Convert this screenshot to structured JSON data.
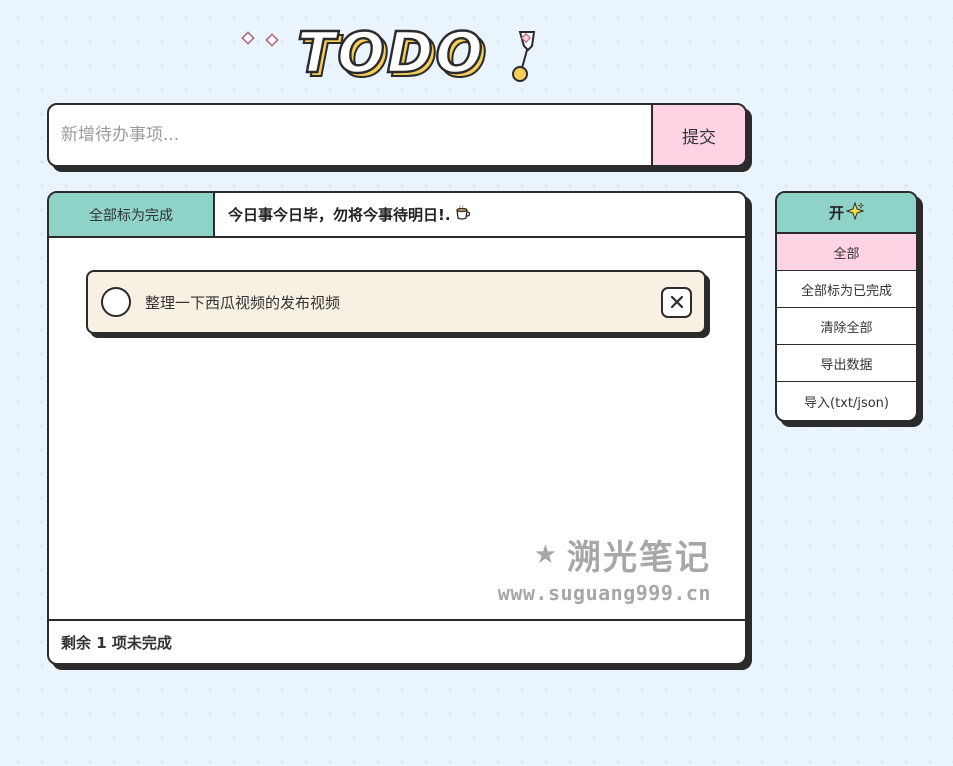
{
  "app": {
    "logo_text": "TODO"
  },
  "input": {
    "placeholder": "新增待办事项...",
    "value": "",
    "submit_label": "提交"
  },
  "panel": {
    "mark_all_label": "全部标为完成",
    "motto": "今日事今日毕，勿将今事待明日!.",
    "motto_icon": "coffee-cup-icon",
    "items": [
      {
        "text": "整理一下西瓜视频的发布视频",
        "completed": false
      }
    ],
    "footer": "剩余 1 项未完成"
  },
  "watermark": {
    "title": "溯光笔记",
    "url": "www.suguang999.cn"
  },
  "side_menu": {
    "header": "开",
    "header_icon": "sparkle-icon",
    "items": [
      {
        "label": "全部",
        "active": true
      },
      {
        "label": "全部标为已完成",
        "active": false
      },
      {
        "label": "清除全部",
        "active": false
      },
      {
        "label": "导出数据",
        "active": false
      },
      {
        "label": "导入(txt/json)",
        "active": false
      }
    ]
  },
  "colors": {
    "background": "#e9f4fd",
    "accent_teal": "#8fd3c8",
    "accent_pink": "#ffd3e4",
    "item_bg": "#f8f1e3",
    "logo_yellow": "#f6cd59",
    "border": "#2b2b2b"
  }
}
